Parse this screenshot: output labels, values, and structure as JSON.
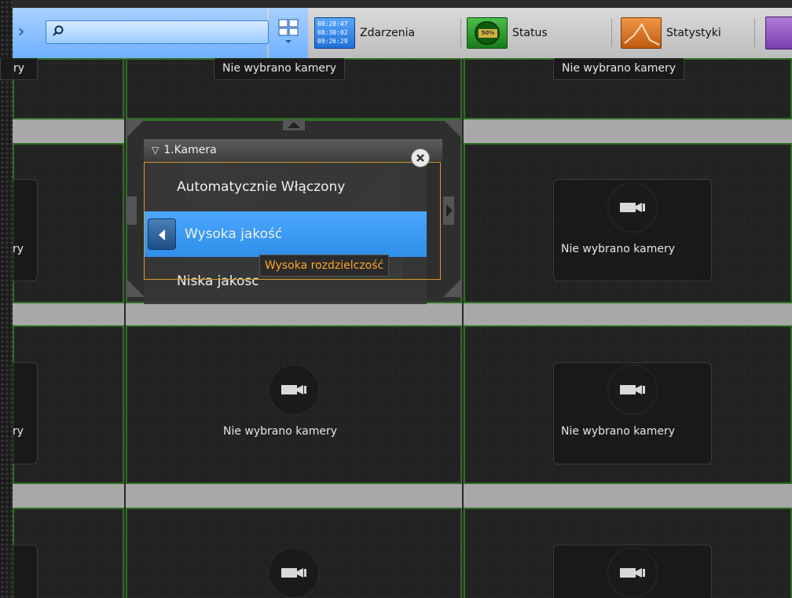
{
  "toolbar": {
    "search_placeholder": "",
    "events_label": "Zdarzenia",
    "events_times": [
      "08:28:47",
      "08:30:02",
      "09:26:29"
    ],
    "status_label": "Status",
    "status_badge": "50%",
    "stats_label": "Statystyki"
  },
  "grid": {
    "no_camera_text": "Nie wybrano kamery",
    "partial_text": "ry"
  },
  "camera_menu": {
    "title": "1.Kamera",
    "items": [
      {
        "label": "Automatycznie Włączony"
      },
      {
        "label": "Wysoka jakość"
      },
      {
        "label": "Niska jakosc"
      }
    ],
    "tooltip": "Wysoka rozdzielczość"
  },
  "colors": {
    "accent": "#3399ff",
    "tile_border": "#2f6e24",
    "tooltip_text": "#ffa52a",
    "toolbar_blue": "#7ab8ff"
  }
}
